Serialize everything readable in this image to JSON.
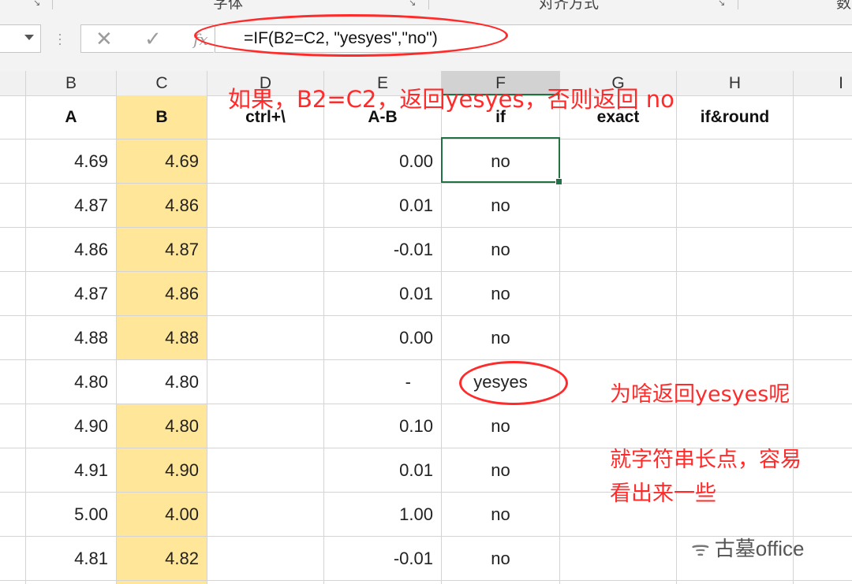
{
  "ribbon": {
    "groups": [
      "字体",
      "对齐方式",
      "数"
    ]
  },
  "formula_bar": {
    "cancel_icon": "✕",
    "confirm_icon": "✓",
    "fx_label": "fx",
    "formula": "=IF(B2=C2, \"yesyes\",\"no\")"
  },
  "columns": [
    "B",
    "C",
    "D",
    "E",
    "F",
    "G",
    "H",
    "I"
  ],
  "selected_column": "F",
  "headers": [
    "A",
    "B",
    "ctrl+\\",
    "A-B",
    "if",
    "exact",
    "if&round"
  ],
  "rows": [
    {
      "b": "4.69",
      "c": "4.69",
      "e": "0.00",
      "f": "no"
    },
    {
      "b": "4.87",
      "c": "4.86",
      "e": "0.01",
      "f": "no"
    },
    {
      "b": "4.86",
      "c": "4.87",
      "e": "-0.01",
      "f": "no"
    },
    {
      "b": "4.87",
      "c": "4.86",
      "e": "0.01",
      "f": "no"
    },
    {
      "b": "4.88",
      "c": "4.88",
      "e": "0.00",
      "f": "no"
    },
    {
      "b": "4.80",
      "c": "4.80",
      "e": "-",
      "f": "yesyes"
    },
    {
      "b": "4.90",
      "c": "4.80",
      "e": "0.10",
      "f": "no"
    },
    {
      "b": "4.91",
      "c": "4.90",
      "e": "0.01",
      "f": "no"
    },
    {
      "b": "5.00",
      "c": "4.00",
      "e": "1.00",
      "f": "no"
    },
    {
      "b": "4.81",
      "c": "4.82",
      "e": "-0.01",
      "f": "no"
    }
  ],
  "annotations": {
    "top": "如果，B2=C2，返回yesyes，否则返回 no",
    "question": "为啥返回yesyes呢",
    "note_line1": "就字符串长点，容易",
    "note_line2": "看出来一些"
  },
  "watermark": {
    "text": "古墓office",
    "icon": "wechat-icon"
  },
  "colors": {
    "highlight": "#ffe699",
    "annotation": "#ff2b2b",
    "selection": "#217346"
  }
}
